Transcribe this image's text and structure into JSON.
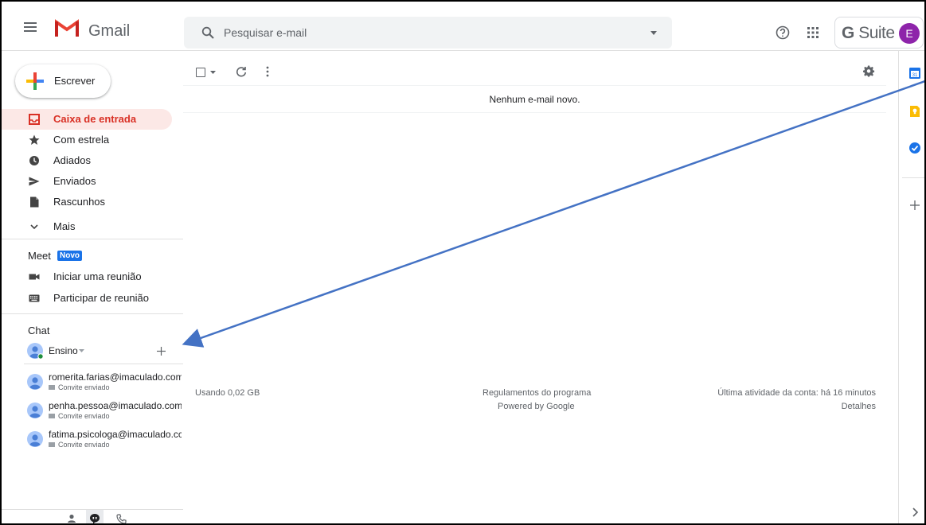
{
  "header": {
    "app_name": "Gmail",
    "search_placeholder": "Pesquisar e-mail",
    "gsuite_g": "G",
    "gsuite_suite": "Suite",
    "avatar_initial": "E"
  },
  "sidebar": {
    "compose_label": "Escrever",
    "items": [
      {
        "label": "Caixa de entrada",
        "icon": "inbox-icon",
        "active": true
      },
      {
        "label": "Com estrela",
        "icon": "star-icon"
      },
      {
        "label": "Adiados",
        "icon": "clock-icon"
      },
      {
        "label": "Enviados",
        "icon": "send-icon"
      },
      {
        "label": "Rascunhos",
        "icon": "draft-icon"
      },
      {
        "label": "Mais",
        "icon": "chevron-down-icon"
      }
    ],
    "meet": {
      "title": "Meet",
      "badge": "Novo",
      "items": [
        {
          "label": "Iniciar uma reunião",
          "icon": "video-icon"
        },
        {
          "label": "Participar de reunião",
          "icon": "keyboard-icon"
        }
      ]
    },
    "chat": {
      "title": "Chat",
      "self_name": "Ensino",
      "contacts": [
        {
          "email": "romerita.farias@imaculado.com",
          "status": "Convite enviado"
        },
        {
          "email": "penha.pessoa@imaculado.com",
          "status": "Convite enviado"
        },
        {
          "email": "fatima.psicologa@imaculado.cc",
          "status": "Convite enviado"
        }
      ]
    }
  },
  "main": {
    "empty_message": "Nenhum e-mail novo.",
    "footer": {
      "storage": "Usando 0,02 GB",
      "program_policies": "Regulamentos do programa",
      "powered_by": "Powered by Google",
      "last_activity": "Última atividade da conta: há 16 minutos",
      "details": "Detalhes"
    }
  },
  "colors": {
    "accent_red": "#d93025",
    "active_bg": "#fce8e6",
    "meet_badge": "#1a73e8",
    "avatar_purple": "#8e24aa",
    "annotation_arrow": "#4472c4"
  }
}
